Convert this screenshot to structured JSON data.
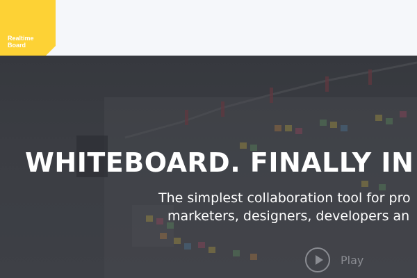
{
  "logo": {
    "line1": "Realtime",
    "line2": "Board"
  },
  "hero": {
    "headline": "WHITEBOARD. FINALLY IN Y",
    "subtitle_line1": "The simplest collaboration tool for pro",
    "subtitle_line2": "marketers, designers, developers an",
    "play_label": "Play"
  },
  "colors": {
    "accent": "#fdd235",
    "hero_bg": "#44464c",
    "text": "#ffffff",
    "play": "#8a8c92"
  },
  "icons": {
    "play": "play-icon"
  }
}
